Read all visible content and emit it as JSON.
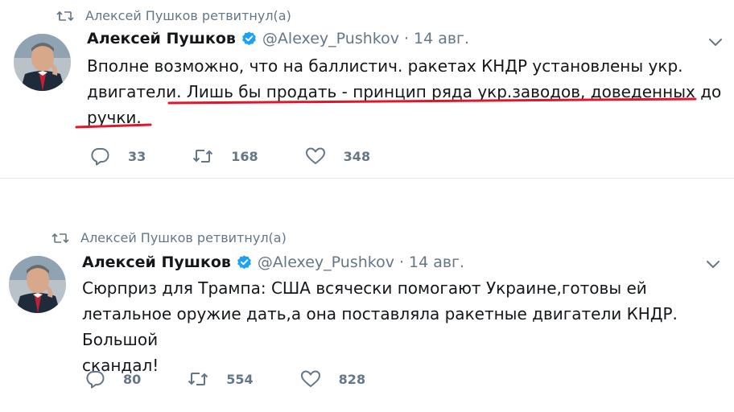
{
  "tweets": [
    {
      "retweet_label": "Алексей Пушков ретвитнул(а)",
      "author_name": "Алексей Пушков",
      "handle": "@Alexey_Pushkov",
      "separator": "·",
      "date": "14 авг.",
      "text_plain": "Вполне возможно, что на баллистич. ракетах КНДР установлены укр. двигатели. ",
      "text_line1": "Вполне возможно, что на баллистич. ракетах КНДР установлены укр.",
      "text_line2_plain": "двигатели. ",
      "text_line2_underlined": "Лишь бы продать - принцип ряда укр.заводов, доведенных до",
      "text_line3_underlined": "ручки.",
      "replies": "33",
      "retweets": "168",
      "likes": "348"
    },
    {
      "retweet_label": "Алексей Пушков ретвитнул(а)",
      "author_name": "Алексей Пушков",
      "handle": "@Alexey_Pushkov",
      "separator": "·",
      "date": "14 авг.",
      "text_line1": "Сюрприз для Трампа: США всячески помогают Украине,готовы ей",
      "text_line2": "летальное оружие дать,а она поставляла ракетные двигатели КНДР. Большой",
      "text_line3": "скандал!",
      "replies": "80",
      "retweets": "554",
      "likes": "828"
    }
  ],
  "colors": {
    "text": "#14171a",
    "secondary": "#657786",
    "verified": "#1da1f2",
    "annotation": "#e0162b"
  },
  "icons": [
    "retweet-icon",
    "verified-badge-icon",
    "chevron-down-icon",
    "reply-icon",
    "like-icon"
  ]
}
